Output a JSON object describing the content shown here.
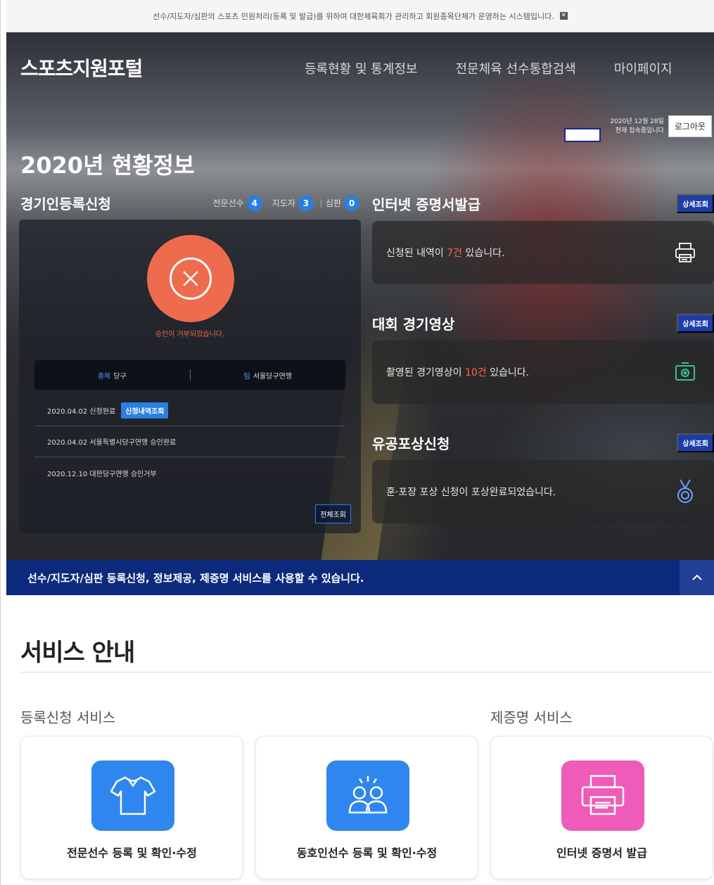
{
  "notice": {
    "text": "선수/지도자/심판의 스포츠 민원처리(등록 및 발급)를 위하여 대한체육회가 관리하고 회원종목단체가 운영하는 시스템입니다."
  },
  "header": {
    "site_title": "스포츠지원포털",
    "nav": [
      "등록현황 및 통계정보",
      "전문체육 선수통합검색",
      "마이페이지"
    ]
  },
  "login": {
    "date": "2020년 12월 28일",
    "status": "현재 접속중입니다",
    "logout_label": "로그아웃"
  },
  "hero": {
    "year_title": "2020년 현황정보"
  },
  "registration": {
    "title": "경기인등록신청",
    "counts": [
      {
        "label": "전문선수",
        "value": "4"
      },
      {
        "label": "지도자",
        "value": "3"
      },
      {
        "label": "심판",
        "value": "0"
      }
    ],
    "status_message": "승인이 거부되었습니다.",
    "sport_label": "종목",
    "sport_value": "당구",
    "org_label": "팀",
    "org_value": "서울당구연맹",
    "history": [
      {
        "text": "2020.04.02 신청완료",
        "button": "신청내역조회"
      },
      {
        "text": "2020.04.02 서울특별시당구연맹 승인완료"
      },
      {
        "text": "2020.12.10 대한당구연맹 승인거부"
      }
    ],
    "all_button": "전체조회"
  },
  "right_sections": [
    {
      "title": "인터넷 증명서발급",
      "detail": "상세조회",
      "msg_pre": "신청된 내역이 ",
      "msg_hl": "7건",
      "msg_post": " 있습니다.",
      "icon": "printer-icon"
    },
    {
      "title": "대회 경기영상",
      "detail": "상세조회",
      "msg_pre": "촬영된 경기영상이 ",
      "msg_hl": "10건",
      "msg_post": " 있습니다.",
      "icon": "video-camera-icon"
    },
    {
      "title": "유공포상신청",
      "detail": "상세조회",
      "msg_pre": "훈·포장 포상 신청이 포상완료되었습니다.",
      "msg_hl": "",
      "msg_post": "",
      "icon": "medal-icon"
    }
  ],
  "banner": {
    "text": "선수/지도자/심판 등록신청, 정보제공, 제증명 서비스를 사용할 수 있습니다."
  },
  "service": {
    "title": "서비스 안내",
    "groups": [
      "등록신청 서비스",
      "제증명 서비스"
    ],
    "cards": [
      {
        "label": "전문선수 등록 및 확인·수정",
        "icon": "uniform-shirt-icon",
        "color": "#2f86ee"
      },
      {
        "label": "동호인선수 등록 및 확인·수정",
        "icon": "people-group-icon",
        "color": "#2f86ee"
      },
      {
        "label": "인터넷 증명서 발급",
        "icon": "printer-icon",
        "color": "#ef5bb8"
      }
    ]
  },
  "colors": {
    "accent_blue": "#2a7fe0",
    "banner_navy": "#0b2a7c",
    "reject": "#ee6b4d",
    "highlight": "#ff6a3c"
  }
}
